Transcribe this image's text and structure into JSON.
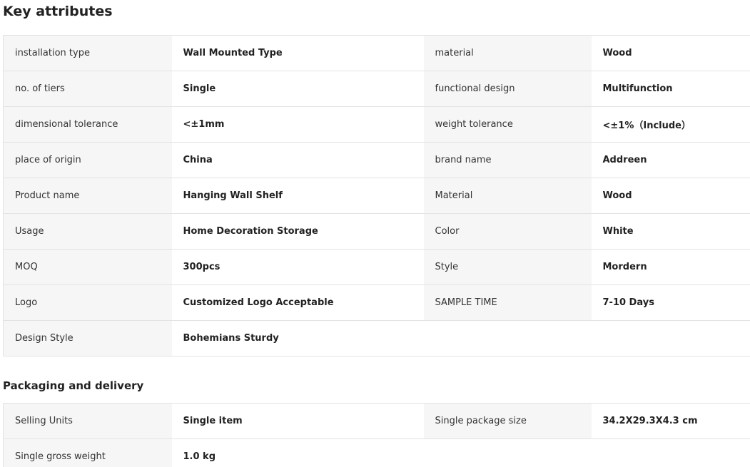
{
  "key_attributes": {
    "title": "Key attributes",
    "rows": [
      {
        "l1": "installation type",
        "v1": "Wall Mounted Type",
        "l2": "material",
        "v2": "Wood"
      },
      {
        "l1": "no. of tiers",
        "v1": "Single",
        "l2": "functional design",
        "v2": "Multifunction"
      },
      {
        "l1": "dimensional tolerance",
        "v1": "<±1mm",
        "l2": "weight tolerance",
        "v2": "<±1%（Include）"
      },
      {
        "l1": "place of origin",
        "v1": "China",
        "l2": "brand name",
        "v2": "Addreen"
      },
      {
        "l1": "Product name",
        "v1": "Hanging Wall Shelf",
        "l2": "Material",
        "v2": "Wood"
      },
      {
        "l1": "Usage",
        "v1": "Home Decoration Storage",
        "l2": "Color",
        "v2": "White"
      },
      {
        "l1": "MOQ",
        "v1": "300pcs",
        "l2": "Style",
        "v2": "Mordern"
      },
      {
        "l1": "Logo",
        "v1": "Customized Logo Acceptable",
        "l2": "SAMPLE TIME",
        "v2": "7-10 Days"
      },
      {
        "l1": "Design Style",
        "v1": "Bohemians Sturdy"
      }
    ]
  },
  "packaging": {
    "title": "Packaging and delivery",
    "rows": [
      {
        "l1": "Selling Units",
        "v1": "Single item",
        "l2": "Single package size",
        "v2": "34.2X29.3X4.3 cm"
      },
      {
        "l1": "Single gross weight",
        "v1": "1.0 kg"
      }
    ]
  },
  "colors": {
    "label_bg": "#f6f6f6",
    "value_bg": "#ffffff",
    "border": "#e3e3e3",
    "text": "#222222"
  }
}
